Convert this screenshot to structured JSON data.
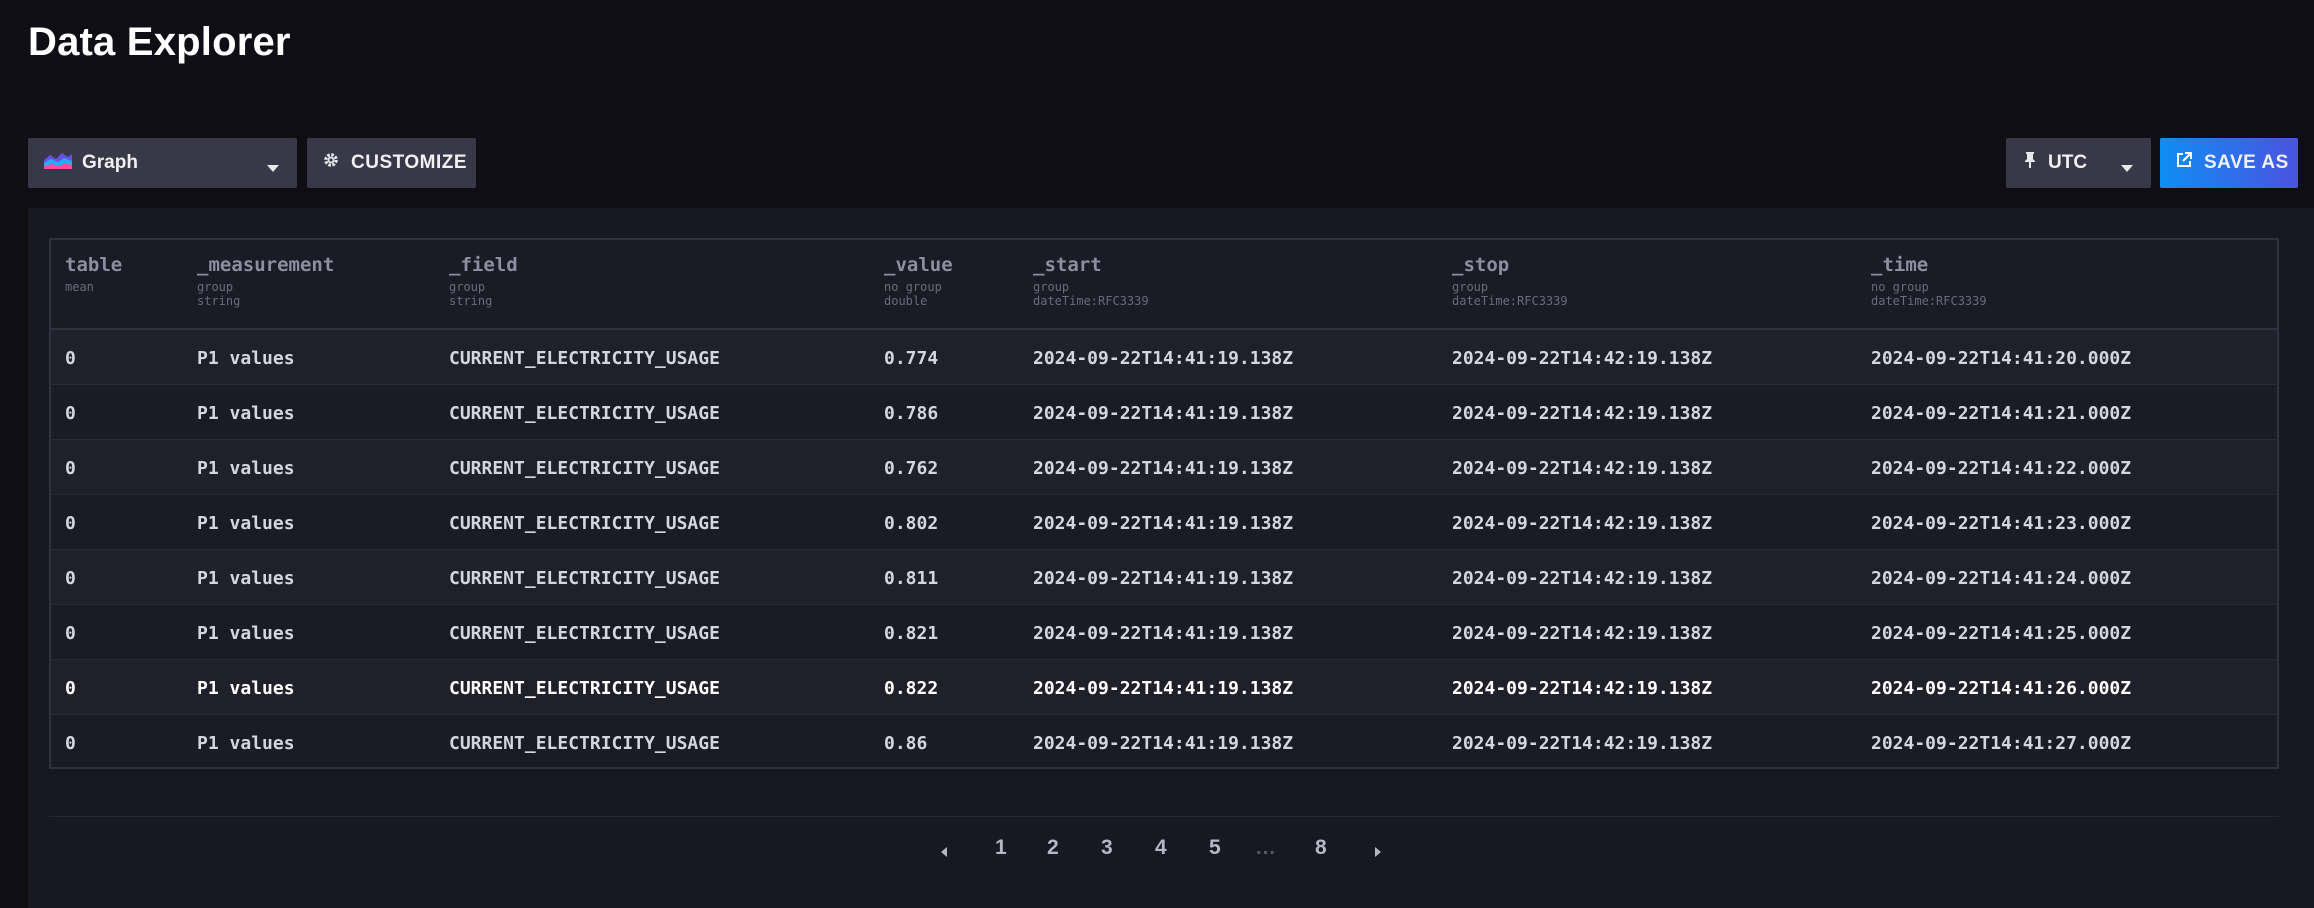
{
  "header": {
    "title": "Data Explorer"
  },
  "toolbar": {
    "view_type": "Graph",
    "customize_label": "CUSTOMIZE",
    "timezone": "UTC",
    "save_as_label": "SAVE AS"
  },
  "table": {
    "columns": [
      {
        "name": "table",
        "sub1": "mean",
        "sub2": ""
      },
      {
        "name": "_measurement",
        "sub1": "group",
        "sub2": "string"
      },
      {
        "name": "_field",
        "sub1": "group",
        "sub2": "string"
      },
      {
        "name": "_value",
        "sub1": "no group",
        "sub2": "double"
      },
      {
        "name": "_start",
        "sub1": "group",
        "sub2": "dateTime:RFC3339"
      },
      {
        "name": "_stop",
        "sub1": "group",
        "sub2": "dateTime:RFC3339"
      },
      {
        "name": "_time",
        "sub1": "no group",
        "sub2": "dateTime:RFC3339"
      }
    ],
    "rows": [
      [
        "0",
        "P1 values",
        "CURRENT_ELECTRICITY_USAGE",
        "0.774",
        "2024-09-22T14:41:19.138Z",
        "2024-09-22T14:42:19.138Z",
        "2024-09-22T14:41:20.000Z"
      ],
      [
        "0",
        "P1 values",
        "CURRENT_ELECTRICITY_USAGE",
        "0.786",
        "2024-09-22T14:41:19.138Z",
        "2024-09-22T14:42:19.138Z",
        "2024-09-22T14:41:21.000Z"
      ],
      [
        "0",
        "P1 values",
        "CURRENT_ELECTRICITY_USAGE",
        "0.762",
        "2024-09-22T14:41:19.138Z",
        "2024-09-22T14:42:19.138Z",
        "2024-09-22T14:41:22.000Z"
      ],
      [
        "0",
        "P1 values",
        "CURRENT_ELECTRICITY_USAGE",
        "0.802",
        "2024-09-22T14:41:19.138Z",
        "2024-09-22T14:42:19.138Z",
        "2024-09-22T14:41:23.000Z"
      ],
      [
        "0",
        "P1 values",
        "CURRENT_ELECTRICITY_USAGE",
        "0.811",
        "2024-09-22T14:41:19.138Z",
        "2024-09-22T14:42:19.138Z",
        "2024-09-22T14:41:24.000Z"
      ],
      [
        "0",
        "P1 values",
        "CURRENT_ELECTRICITY_USAGE",
        "0.821",
        "2024-09-22T14:41:19.138Z",
        "2024-09-22T14:42:19.138Z",
        "2024-09-22T14:41:25.000Z"
      ],
      [
        "0",
        "P1 values",
        "CURRENT_ELECTRICITY_USAGE",
        "0.822",
        "2024-09-22T14:41:19.138Z",
        "2024-09-22T14:42:19.138Z",
        "2024-09-22T14:41:26.000Z"
      ],
      [
        "0",
        "P1 values",
        "CURRENT_ELECTRICITY_USAGE",
        "0.86",
        "2024-09-22T14:41:19.138Z",
        "2024-09-22T14:42:19.138Z",
        "2024-09-22T14:41:27.000Z"
      ]
    ]
  },
  "pagination": {
    "pages": [
      "1",
      "2",
      "3",
      "4",
      "5",
      "…",
      "8"
    ]
  },
  "icons": {
    "view_type": "graph-icon",
    "customize": "gear-icon",
    "timezone": "pin-icon",
    "save_as": "export-icon"
  },
  "colors": {
    "accent_start": "#0f8ef2",
    "accent_end": "#4a53e0"
  }
}
